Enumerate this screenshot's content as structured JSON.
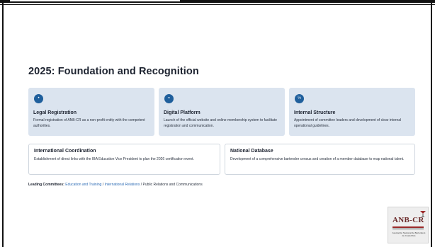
{
  "section": {
    "title": "2025: Foundation and Recognition"
  },
  "cards_top": [
    {
      "icon": "document-icon",
      "title": "Legal Registration",
      "description": "Formal registration of ANB-CR as a non-profit entity with the competent authorities."
    },
    {
      "icon": "globe-icon",
      "title": "Digital Platform",
      "description": "Launch of the official website and online membership system to facilitate registration and communication."
    },
    {
      "icon": "people-icon",
      "title": "Internal Structure",
      "description": "Appointment of committee leaders and development of clear internal operational guidelines."
    }
  ],
  "cards_bottom": [
    {
      "title": "International Coordination",
      "description": "Establishment of direct links with the IBA Education Vice President to plan the 2026 certification event."
    },
    {
      "title": "National Database",
      "description": "Development of a comprehensive bartender census and creation of a member database to map national talent."
    }
  ],
  "committees": {
    "label": "Leading Committees:",
    "link1": "Education and Training",
    "sep1": " / ",
    "link2": "International Relations",
    "rest": " / Public Relations and Communications"
  },
  "logo": {
    "text": "ANB-CR",
    "subtitle": "Asociación Nacional de Bartenders de Costa Rica",
    "icon": "cocktail-glass-icon"
  },
  "colors": {
    "accent": "#1f5f9c",
    "card_blue": "#dbe4ef",
    "link": "#2f6db5"
  }
}
